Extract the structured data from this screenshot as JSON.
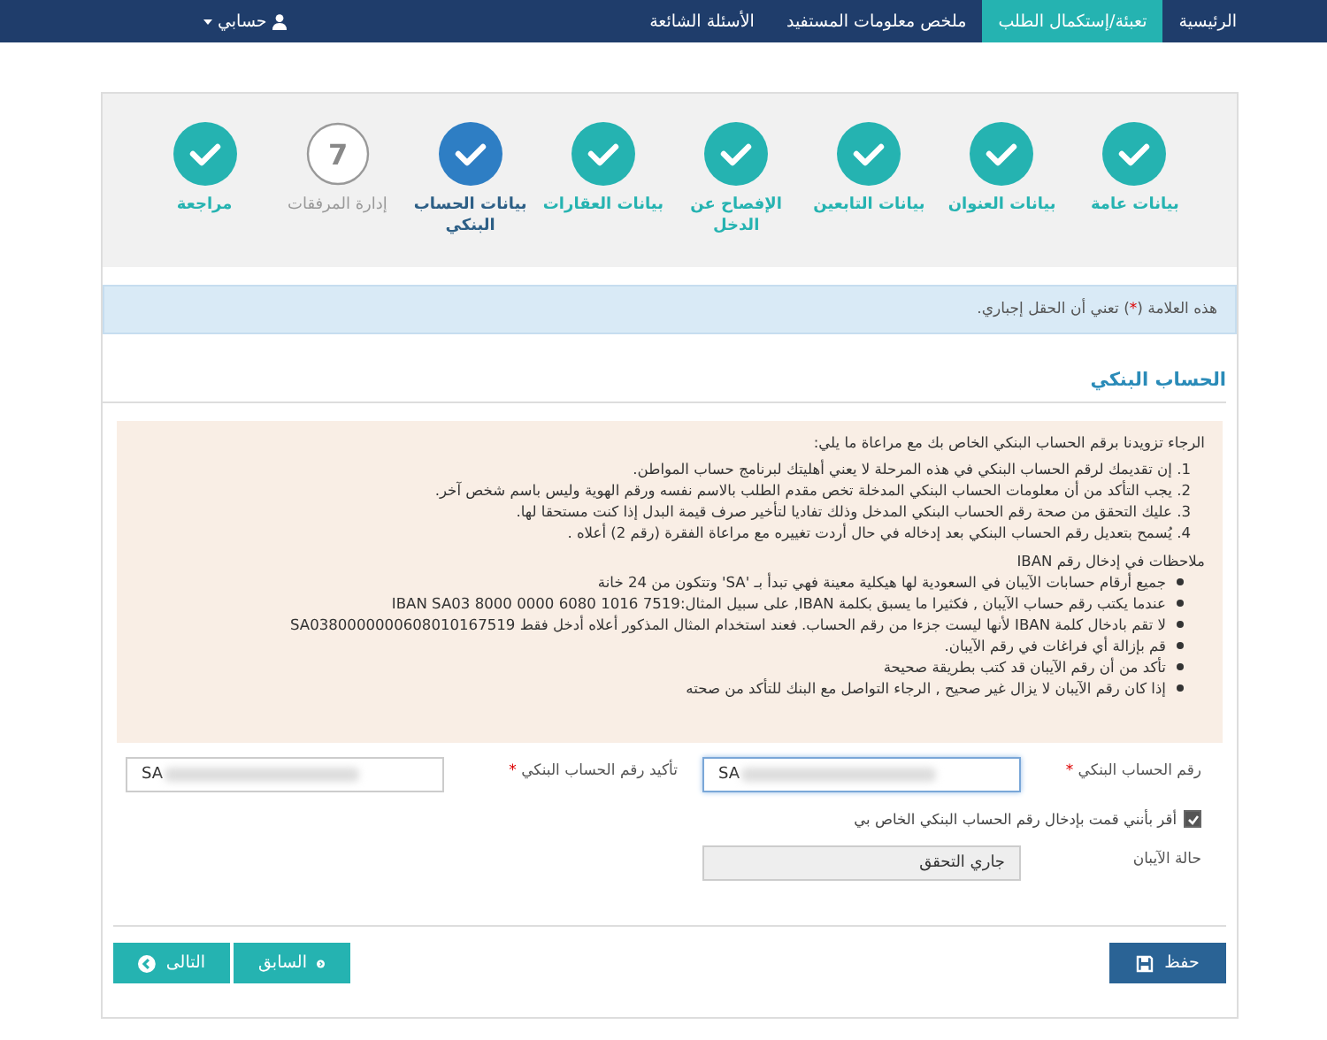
{
  "nav": {
    "items": [
      {
        "label": "الرئيسية",
        "selected": false
      },
      {
        "label": "تعبئة/إستكمال الطلب",
        "selected": true
      },
      {
        "label": "ملخص معلومات المستفيد",
        "selected": false
      },
      {
        "label": "الأسئلة الشائعة",
        "selected": false
      }
    ],
    "account": "حسابي"
  },
  "steps": [
    {
      "label": "بيانات عامة",
      "completed": true,
      "selected": false
    },
    {
      "label": "بيانات العنوان",
      "completed": true,
      "selected": false
    },
    {
      "label": "بيانات التابعين",
      "completed": true,
      "selected": false
    },
    {
      "label": "الإفصاح عن الدخل",
      "completed": true,
      "selected": false
    },
    {
      "label": "بيانات العقارات",
      "completed": true,
      "selected": false
    },
    {
      "label": "بيانات الحساب البنكي",
      "completed": true,
      "selected": true
    },
    {
      "label": "إدارة المرفقات",
      "completed": false,
      "selected": false,
      "number": "7"
    },
    {
      "label": "مراجعة",
      "completed": true,
      "selected": false
    }
  ],
  "notice": {
    "before": "هذه العلامة (",
    "mark": "*",
    "after": ") تعني أن الحقل إجباري."
  },
  "section_title": "الحساب البنكي",
  "instructions": {
    "intro": "الرجاء تزويدنا برقم الحساب البنكي الخاص بك مع مراعاة ما يلي:",
    "points": [
      "1. إن تقديمك لرقم الحساب البنكي في هذه المرحلة لا يعني أهليتك لبرنامج حساب المواطن.",
      "2. يجب التأكد من أن معلومات الحساب البنكي المدخلة تخص مقدم الطلب بالاسم نفسه ورقم الهوية وليس باسم شخص آخر.",
      "3. عليك التحقق من صحة رقم الحساب البنكي المدخل وذلك تفاديا لتأخير صرف قيمة البدل إذا كنت مستحقا لها.",
      "4. يُسمح بتعديل رقم الحساب البنكي بعد إدخاله في حال أردت تغييره مع مراعاة الفقرة (رقم 2) أعلاه ."
    ],
    "iban_title": "ملاحظات في إدخال رقم IBAN",
    "iban_notes": [
      "جميع أرقام حسابات الآيبان في السعودية لها هيكلية معينة فهي تبدأ بـ 'SA' وتتكون من 24 خانة",
      "عندما يكتب رقم حساب الآيبان , فكثيرا ما يسبق بكلمة IBAN, على سبيل المثال:IBAN SA03 8000 0000 6080 1016 7519",
      "لا تقم بادخال كلمة IBAN لأنها ليست جزءا من رقم الحساب. فعند استخدام المثال المذكور أعلاه أدخل فقط SA0380000000608010167519",
      "قم بإزالة أي فراغات في رقم الآيبان.",
      "تأكد من أن رقم الآيبان قد كتب بطريقة صحيحة",
      "إذا كان رقم الآيبان لا يزال غير صحيح , الرجاء التواصل مع البنك للتأكد من صحته"
    ]
  },
  "form": {
    "iban": {
      "label": "رقم الحساب البنكي",
      "required": true,
      "value": "SA",
      "focused": true
    },
    "confirm": {
      "label": "تأكيد رقم الحساب البنكي",
      "required": true,
      "value": "SA",
      "focused": false
    },
    "agree": {
      "label": "أقر بأنني قمت بإدخال رقم الحساب البنكي الخاص بي",
      "checked": true
    },
    "status": {
      "label": "حالة الآيبان",
      "value": "جاري التحقق",
      "disabled": true
    }
  },
  "buttons": {
    "save": "حفظ",
    "previous": "السابق",
    "next": "التالى"
  }
}
